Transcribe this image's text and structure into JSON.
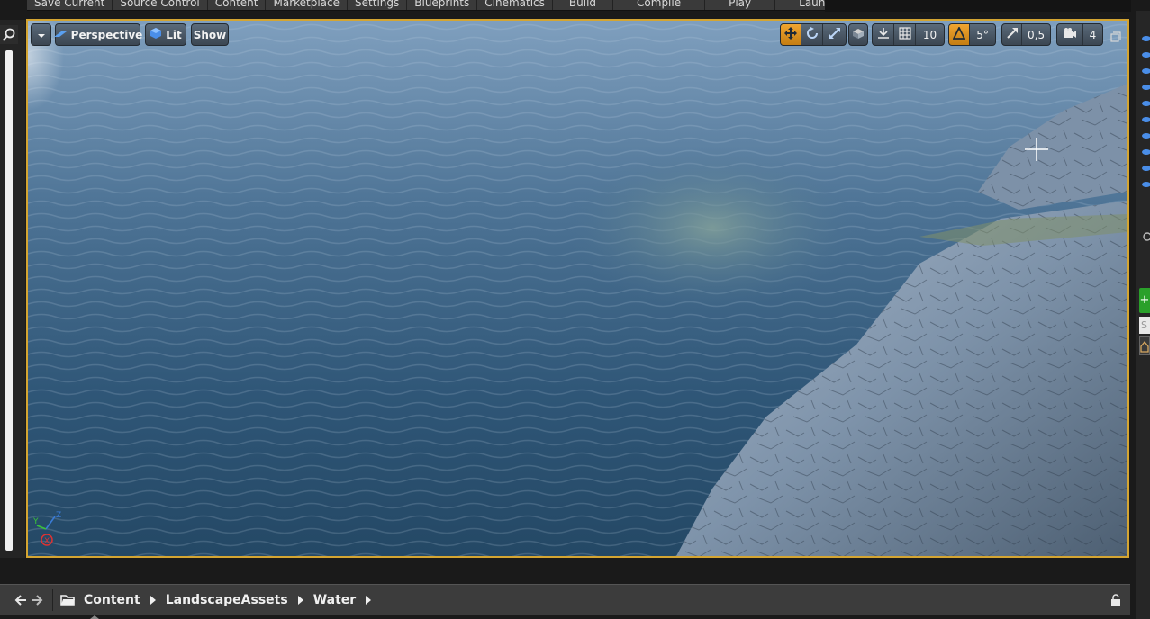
{
  "top_toolbar": {
    "buttons": [
      "Save Current",
      "Source Control",
      "Content",
      "Marketplace",
      "Settings",
      "Blueprints",
      "Cinematics",
      "Build",
      "Compile",
      "Play",
      "Launch"
    ]
  },
  "viewport": {
    "toolbar": {
      "view_mode": "Perspective",
      "lighting": "Lit",
      "show": "Show",
      "grid_snap_value": "10",
      "rotation_snap_value": "5°",
      "scale_snap_value": "0,5",
      "camera_speed_value": "4"
    },
    "axis_labels": {
      "x": "X",
      "y": "Y",
      "z": "Z"
    }
  },
  "content_browser": {
    "breadcrumbs": [
      "Content",
      "LandscapeAssets",
      "Water"
    ]
  },
  "right_panel": {
    "search_placeholder": "S"
  },
  "colors": {
    "viewport_border": "#d4a532",
    "active_snap": "#e8961e",
    "water_deep": "#2b4f6e",
    "rock": "#8aa0b8"
  }
}
